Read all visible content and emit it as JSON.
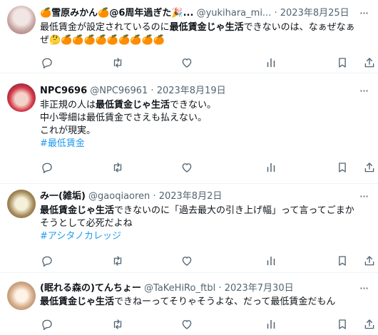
{
  "tweets": [
    {
      "display_name": "🍊雪原みかん🍊@6周年過ぎた🎉...",
      "handle": "@yukihara_mi...",
      "dot": "·",
      "date": "2023年8月25日",
      "more": "···",
      "lines": [
        {
          "segments": [
            {
              "text": "最低賃金が設定されているのに",
              "style": "normal"
            },
            {
              "text": "最低賃金じゃ生活",
              "style": "bold"
            },
            {
              "text": "できないのは、なぁぜなぁ",
              "style": "normal"
            }
          ]
        },
        {
          "segments": [
            {
              "text": "ぜ🤔🍊🍊🍊🍊🍊🍊🍊🍊🍊",
              "style": "normal"
            }
          ]
        }
      ]
    },
    {
      "display_name": "NPC9696",
      "handle": "@NPC96961",
      "dot": "·",
      "date": "2023年8月19日",
      "more": "···",
      "lines": [
        {
          "segments": [
            {
              "text": "非正規の人は",
              "style": "normal"
            },
            {
              "text": "最低賃金じゃ生活",
              "style": "bold"
            },
            {
              "text": "できない。",
              "style": "normal"
            }
          ]
        },
        {
          "segments": [
            {
              "text": "中小零細は最低賃金でさえも払えない。",
              "style": "normal"
            }
          ]
        },
        {
          "segments": [
            {
              "text": "これが現実。",
              "style": "normal"
            }
          ]
        },
        {
          "segments": [
            {
              "text": "#最低賃金",
              "style": "hashtag"
            }
          ]
        }
      ]
    },
    {
      "display_name": "み一(雑垢)",
      "handle": "@gaoqiaoren",
      "dot": "·",
      "date": "2023年8月2日",
      "more": "···",
      "lines": [
        {
          "segments": [
            {
              "text": "最低賃金じゃ生活",
              "style": "bold"
            },
            {
              "text": "できないのに「過去最大の引き上げ幅」って言ってごまか",
              "style": "normal"
            }
          ]
        },
        {
          "segments": [
            {
              "text": "そうとして必死だよね",
              "style": "normal"
            }
          ]
        },
        {
          "segments": [
            {
              "text": "#アシタノカレッジ",
              "style": "hashtag"
            }
          ]
        }
      ]
    },
    {
      "display_name": "(眠れる森の)てんちょー",
      "handle": "@TaKeHiRo_ftbl",
      "dot": "·",
      "date": "2023年7月30日",
      "more": "···",
      "lines": [
        {
          "segments": [
            {
              "text": "最低賃金じゃ生活",
              "style": "bold"
            },
            {
              "text": "できねーってそりゃそうよな、だって最低賃金だもん",
              "style": "normal"
            }
          ]
        }
      ]
    }
  ],
  "colors": {
    "text": "#0f1419",
    "meta": "#536471",
    "hashtag": "#1d9bf0",
    "divider": "#eff3f4"
  },
  "action_icons": [
    "reply-icon",
    "retweet-icon",
    "like-icon",
    "views-icon",
    "bookmark-icon",
    "share-icon"
  ]
}
